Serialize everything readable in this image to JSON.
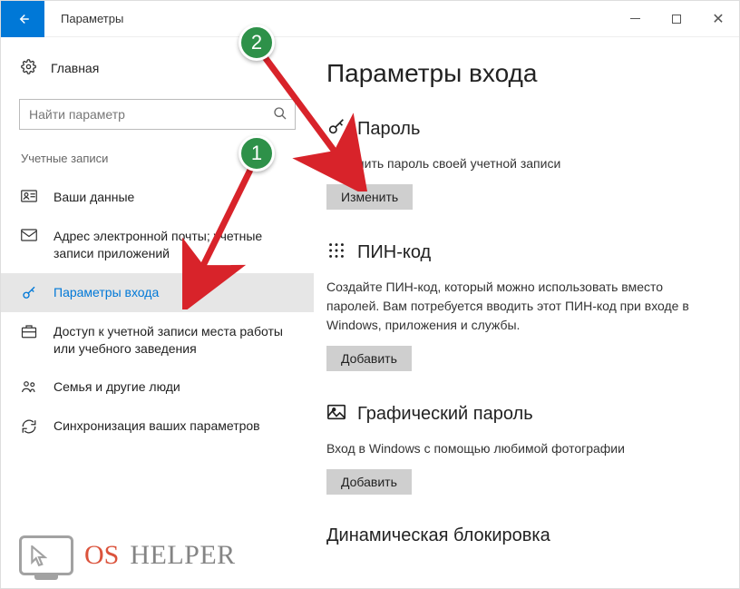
{
  "window": {
    "title": "Параметры"
  },
  "sidebar": {
    "home": "Главная",
    "search_placeholder": "Найти параметр",
    "category": "Учетные записи",
    "items": [
      {
        "label": "Ваши данные"
      },
      {
        "label": "Адрес электронной почты; учетные записи приложений"
      },
      {
        "label": "Параметры входа"
      },
      {
        "label": "Доступ к учетной записи места работы или учебного заведения"
      },
      {
        "label": "Семья и другие люди"
      },
      {
        "label": "Синхронизация ваших параметров"
      }
    ]
  },
  "main": {
    "heading": "Параметры входа",
    "password": {
      "title": "Пароль",
      "desc": "Изменить пароль своей учетной записи",
      "button": "Изменить"
    },
    "pin": {
      "title": "ПИН-код",
      "desc": "Создайте ПИН-код, который можно использовать вместо паролей. Вам потребуется вводить этот ПИН-код при входе в Windows, приложения и службы.",
      "button": "Добавить"
    },
    "picture": {
      "title": "Графический пароль",
      "desc": "Вход в Windows с помощью любимой фотографии",
      "button": "Добавить"
    },
    "dynamic": {
      "title": "Динамическая блокировка"
    }
  },
  "annotations": {
    "b1": "1",
    "b2": "2"
  },
  "watermark": {
    "t1": "OS",
    "t2": "HELPER"
  }
}
